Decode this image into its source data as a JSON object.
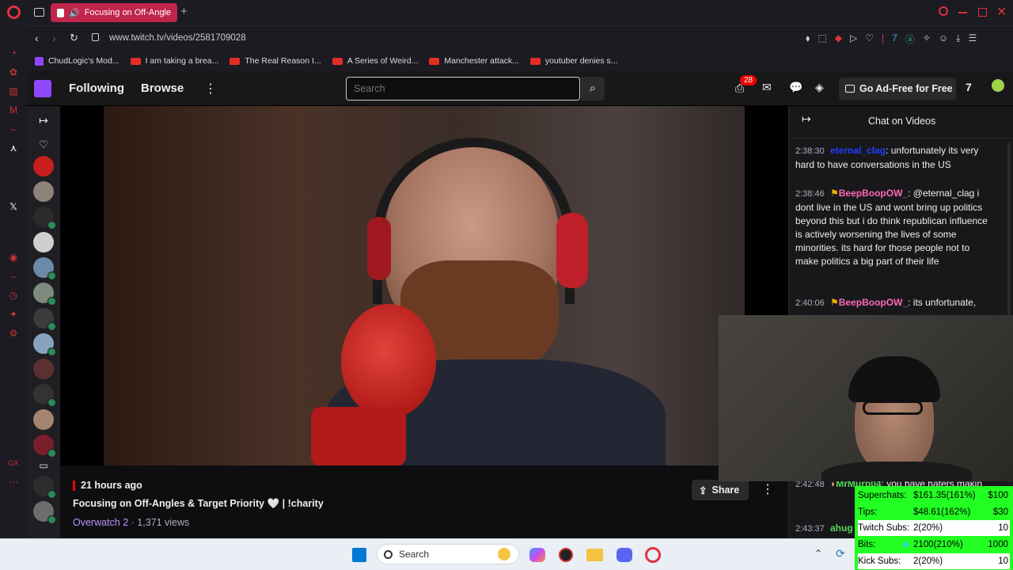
{
  "browser": {
    "tab_title": "Focusing on Off-Angle",
    "url": "www.twitch.tv/videos/2581709028",
    "bookmarks": [
      {
        "label": "ChudLogic's Mod..."
      },
      {
        "label": "I am taking a brea..."
      },
      {
        "label": "The Real Reason I..."
      },
      {
        "label": "A Series of Weird..."
      },
      {
        "label": "Manchester attack..."
      },
      {
        "label": "youtuber denies s..."
      }
    ]
  },
  "twitch": {
    "nav": {
      "following": "Following",
      "browse": "Browse",
      "search_placeholder": "Search",
      "notification_count": "28",
      "ad_free": "Go Ad-Free for Free"
    },
    "video": {
      "age": "21 hours ago",
      "title": "Focusing on Off-Angles & Target Priority 🤍 | !charity",
      "game": "Overwatch 2",
      "views": "1,371 views",
      "share": "Share"
    },
    "chat": {
      "header": "Chat on Videos",
      "messages": [
        {
          "time": "2:38:30",
          "user": "eternal_clag",
          "text": ": unfortunately its very hard to have conversations in the US",
          "color": "#1e40ff"
        },
        {
          "time": "2:38:46",
          "user": "BeepBoopOW_",
          "text": ": @eternal_clag i dont live in the US and wont bring up politics beyond this but i do think republican influence is actively worsening the lives of some minorities. its hard for those people not to make politics a big part of their life",
          "color": "#ff69b4"
        },
        {
          "time": "2:40:06",
          "user": "BeepBoopOW_",
          "text": ": its unfortunate,",
          "color": "#ff69b4"
        },
        {
          "time": "2:42:48",
          "user": "MrMurp04",
          "text": ": you have haters makin",
          "color": "#58d858"
        },
        {
          "time": "2:43:37",
          "user": "ahug",
          "text": "",
          "color": "#58d858"
        }
      ]
    }
  },
  "overlay": {
    "rows": [
      {
        "label": "Superchats:",
        "amount": "$161.35(161%)",
        "goal": "$100"
      },
      {
        "label": "Tips:",
        "amount": "$48.61(162%)",
        "goal": "$30"
      },
      {
        "label": "Twitch Subs:",
        "amount": "2(20%)",
        "goal": "10"
      },
      {
        "label": "Bits:",
        "amount": "2100(210%)",
        "goal": "1000"
      },
      {
        "label": "Kick Subs:",
        "amount": "2(20%)",
        "goal": "10"
      }
    ]
  },
  "taskbar": {
    "search": "Search"
  }
}
